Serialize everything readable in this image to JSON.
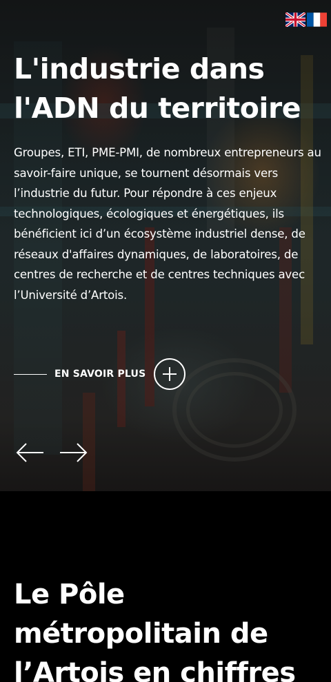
{
  "languages": [
    {
      "code": "en",
      "label": "English"
    },
    {
      "code": "fr",
      "label": "Français"
    }
  ],
  "hero": {
    "title_line1": "L'industrie dans",
    "title_line2": "l'ADN du territoire",
    "text": "Groupes, ETI, PME-PMI, de nombreux entrepreneurs au savoir-faire unique, se tournent désormais vers l’industrie du futur. Pour répondre à ces enjeux technologiques, écologiques et énergétiques, ils bénéficient ici d’un écosystème industriel dense, de réseaux d'affaires dynamiques, de laboratoires, de centres de recherche et de centres techniques avec l’Université d’Artois.",
    "more_label": "EN SAVOIR PLUS",
    "more_icon": "plus-icon",
    "prev_icon": "arrow-left-icon",
    "next_icon": "arrow-right-icon"
  },
  "section2": {
    "title_line1": "Le Pôle",
    "title_line2": "métropolitain de",
    "title_line3": "l’Artois en chiffres"
  },
  "colors": {
    "text": "#ffffff",
    "background": "#000000",
    "flag_blue": "#012169",
    "flag_red": "#C8102E",
    "fr_blue": "#0055A4",
    "fr_red": "#EF4135"
  }
}
